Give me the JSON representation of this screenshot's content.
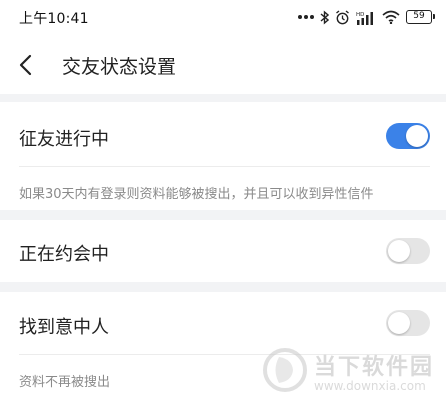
{
  "status_bar": {
    "time": "上午10:41",
    "battery": "59",
    "icons": [
      "dots-icon",
      "bluetooth-icon",
      "alarm-icon",
      "hd-signal-icon",
      "wifi-icon",
      "battery-icon"
    ]
  },
  "nav": {
    "title": "交友状态设置",
    "back_icon": "chevron-left-icon"
  },
  "settings": [
    {
      "label": "征友进行中",
      "enabled": true,
      "description": "如果30天内有登录则资料能够被搜出，并且可以收到异性信件"
    },
    {
      "label": "正在约会中",
      "enabled": false,
      "description": ""
    },
    {
      "label": "找到意中人",
      "enabled": false,
      "description": "资料不再被搜出"
    }
  ],
  "watermark": {
    "name": "当下软件园",
    "url": "www.downxia.com"
  },
  "colors": {
    "accent": "#3b82e8",
    "switch_off": "#e5e5e5",
    "section_gap": "#f2f3f5",
    "secondary_text": "#8a8a8a"
  }
}
